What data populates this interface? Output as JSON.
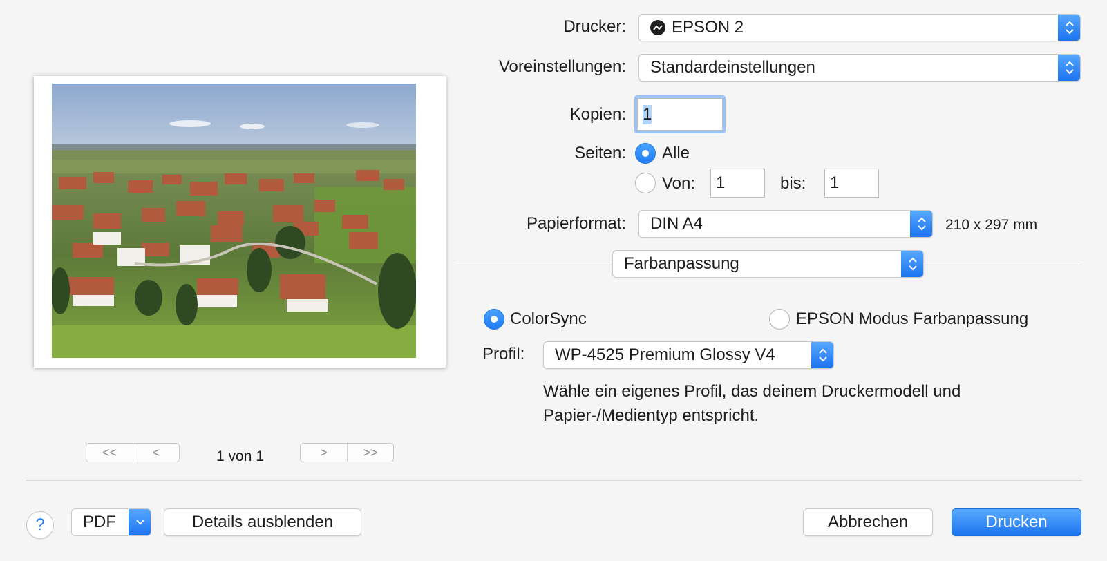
{
  "printer": {
    "label": "Drucker:",
    "value": "EPSON 2"
  },
  "presets": {
    "label": "Voreinstellungen:",
    "value": "Standardeinstellungen"
  },
  "copies": {
    "label": "Kopien:",
    "value": "1"
  },
  "pages": {
    "label": "Seiten:",
    "all_label": "Alle",
    "from_label": "Von:",
    "from_value": "1",
    "to_label": "bis:",
    "to_value": "1",
    "selected": "all"
  },
  "paper": {
    "label": "Papierformat:",
    "value": "DIN A4",
    "size_text": "210 x 297 mm"
  },
  "section": {
    "value": "Farbanpassung"
  },
  "color_matching": {
    "colorsync_label": "ColorSync",
    "epson_label": "EPSON Modus Farbanpassung",
    "selected": "colorsync",
    "profile_label": "Profil:",
    "profile_value": "WP-4525 Premium Glossy V4",
    "hint_line1": "Wähle ein eigenes Profil, das deinem Druckermodell und",
    "hint_line2": "Papier-/Medientyp entspricht."
  },
  "preview_nav": {
    "first": "<<",
    "prev": "<",
    "next": ">",
    "last": ">>",
    "page_text": "1 von 1"
  },
  "footer": {
    "help": "?",
    "pdf": "PDF",
    "details": "Details ausblenden",
    "cancel": "Abbrechen",
    "print": "Drucken"
  },
  "colors": {
    "accent": "#1f7bf2"
  }
}
